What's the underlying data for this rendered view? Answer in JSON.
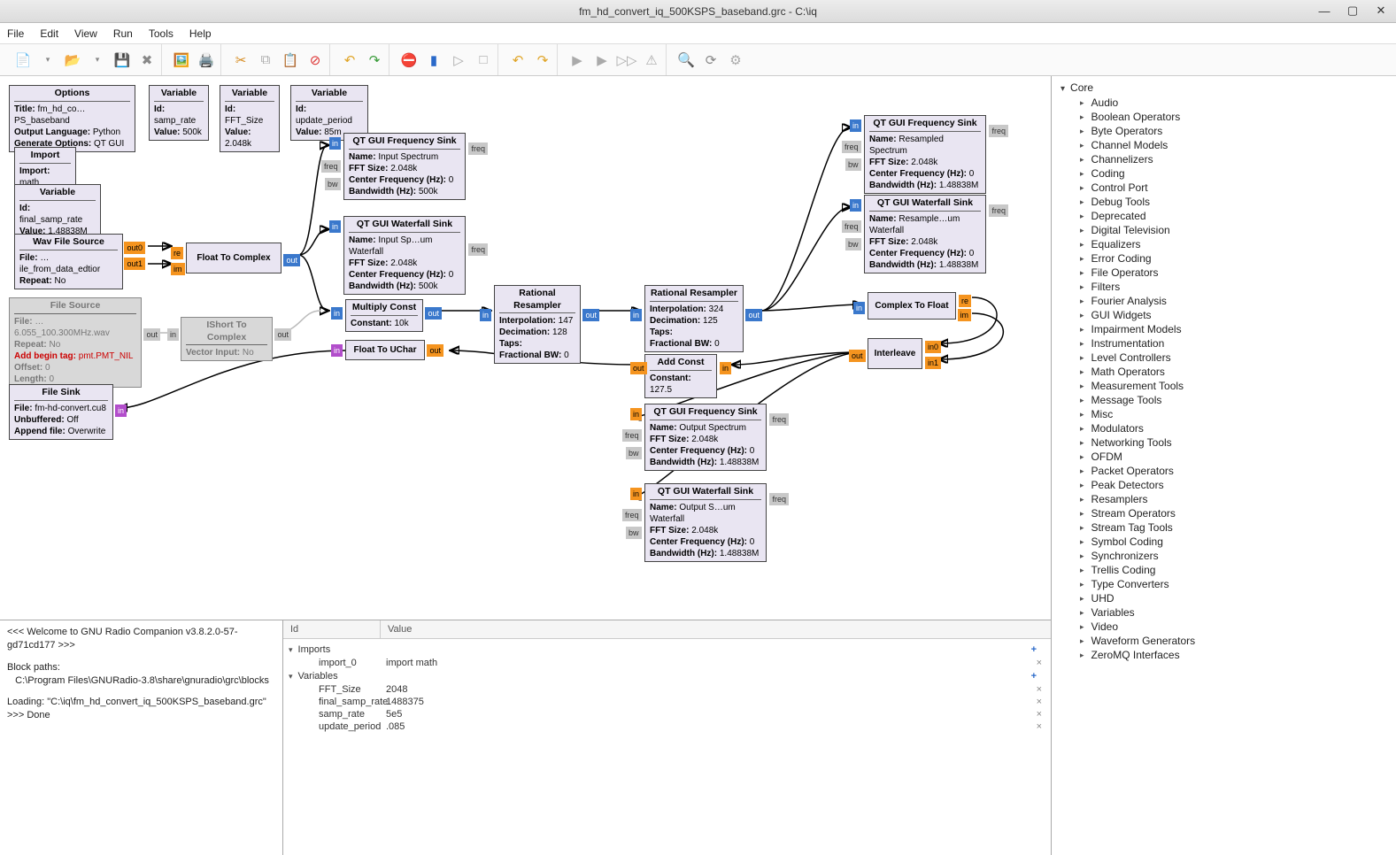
{
  "titlebar": {
    "title": "fm_hd_convert_iq_500KSPS_baseband.grc - C:\\iq"
  },
  "menu": [
    "File",
    "Edit",
    "View",
    "Run",
    "Tools",
    "Help"
  ],
  "sidebar": {
    "root": "Core",
    "items": [
      "Audio",
      "Boolean Operators",
      "Byte Operators",
      "Channel Models",
      "Channelizers",
      "Coding",
      "Control Port",
      "Debug Tools",
      "Deprecated",
      "Digital Television",
      "Equalizers",
      "Error Coding",
      "File Operators",
      "Filters",
      "Fourier Analysis",
      "GUI Widgets",
      "Impairment Models",
      "Instrumentation",
      "Level Controllers",
      "Math Operators",
      "Measurement Tools",
      "Message Tools",
      "Misc",
      "Modulators",
      "Networking Tools",
      "OFDM",
      "Packet Operators",
      "Peak Detectors",
      "Resamplers",
      "Stream Operators",
      "Stream Tag Tools",
      "Symbol Coding",
      "Synchronizers",
      "Trellis Coding",
      "Type Converters",
      "UHD",
      "Variables",
      "Video",
      "Waveform Generators",
      "ZeroMQ Interfaces"
    ]
  },
  "console": {
    "welcome": "<<< Welcome to GNU Radio Companion v3.8.2.0-57-gd71cd177 >>>",
    "paths_label": "Block paths:",
    "paths": "C:\\Program Files\\GNURadio-3.8\\share\\gnuradio\\grc\\blocks",
    "loading": "Loading: \"C:\\iq\\fm_hd_convert_iq_500KSPS_baseband.grc\"",
    "done": ">>> Done"
  },
  "vars": {
    "col_id": "Id",
    "col_val": "Value",
    "sec_imports": "Imports",
    "import_id": "import_0",
    "import_val": "import math",
    "sec_vars": "Variables",
    "rows": [
      {
        "id": "FFT_Size",
        "val": "2048"
      },
      {
        "id": "final_samp_rate",
        "val": "1488375"
      },
      {
        "id": "samp_rate",
        "val": "5e5"
      },
      {
        "id": "update_period",
        "val": ".085"
      }
    ]
  },
  "blocks": {
    "options": {
      "t": "Options",
      "l1": "Title:",
      "v1": "fm_hd_co…PS_baseband",
      "l2": "Output Language:",
      "v2": "Python",
      "l3": "Generate Options:",
      "v3": "QT GUI"
    },
    "var1": {
      "t": "Variable",
      "l1": "Id:",
      "v1": "samp_rate",
      "l2": "Value:",
      "v2": "500k"
    },
    "var2": {
      "t": "Variable",
      "l1": "Id:",
      "v1": "FFT_Size",
      "l2": "Value:",
      "v2": "2.048k"
    },
    "var3": {
      "t": "Variable",
      "l1": "Id:",
      "v1": "update_period",
      "l2": "Value:",
      "v2": "85m"
    },
    "import": {
      "t": "Import",
      "l1": "Import:",
      "v1": "math"
    },
    "var4": {
      "t": "Variable",
      "l1": "Id:",
      "v1": "final_samp_rate",
      "l2": "Value:",
      "v2": "1.48838M"
    },
    "wavsrc": {
      "t": "Wav File Source",
      "l1": "File:",
      "v1": "…ile_from_data_edtior",
      "l2": "Repeat:",
      "v2": "No"
    },
    "filesrc": {
      "t": "File Source",
      "l1": "File:",
      "v1": "…6.055_100.300MHz.wav",
      "l2": "Repeat:",
      "v2": "No",
      "l3": "Add begin tag:",
      "v3": "pmt.PMT_NIL",
      "l4": "Offset:",
      "v4": "0",
      "l5": "Length:",
      "v5": "0"
    },
    "filesink": {
      "t": "File Sink",
      "l1": "File:",
      "v1": "fm-hd-convert.cu8",
      "l2": "Unbuffered:",
      "v2": "Off",
      "l3": "Append file:",
      "v3": "Overwrite"
    },
    "f2c": {
      "t": "Float To Complex"
    },
    "is2c": {
      "t": "IShort To Complex",
      "l1": "Vector Input:",
      "v1": "No"
    },
    "freqsink1": {
      "t": "QT GUI Frequency Sink",
      "l1": "Name:",
      "v1": "Input Spectrum",
      "l2": "FFT Size:",
      "v2": "2.048k",
      "l3": "Center Frequency (Hz):",
      "v3": "0",
      "l4": "Bandwidth (Hz):",
      "v4": "500k"
    },
    "wfsink1": {
      "t": "QT GUI Waterfall Sink",
      "l1": "Name:",
      "v1": "Input Sp…um Waterfall",
      "l2": "FFT Size:",
      "v2": "2.048k",
      "l3": "Center Frequency (Hz):",
      "v3": "0",
      "l4": "Bandwidth (Hz):",
      "v4": "500k"
    },
    "mulconst": {
      "t": "Multiply Const",
      "l1": "Constant:",
      "v1": "10k"
    },
    "f2uc": {
      "t": "Float To UChar"
    },
    "rr1": {
      "t": "Rational Resampler",
      "l1": "Interpolation:",
      "v1": "147",
      "l2": "Decimation:",
      "v2": "128",
      "l3": "Taps:",
      "v3": "",
      "l4": "Fractional BW:",
      "v4": "0"
    },
    "rr2": {
      "t": "Rational Resampler",
      "l1": "Interpolation:",
      "v1": "324",
      "l2": "Decimation:",
      "v2": "125",
      "l3": "Taps:",
      "v3": "",
      "l4": "Fractional BW:",
      "v4": "0"
    },
    "addconst": {
      "t": "Add Const",
      "l1": "Constant:",
      "v1": "127.5"
    },
    "freqsink2": {
      "t": "QT GUI Frequency Sink",
      "l1": "Name:",
      "v1": "Output Spectrum",
      "l2": "FFT Size:",
      "v2": "2.048k",
      "l3": "Center Frequency (Hz):",
      "v3": "0",
      "l4": "Bandwidth (Hz):",
      "v4": "1.48838M"
    },
    "wfsink2": {
      "t": "QT GUI Waterfall Sink",
      "l1": "Name:",
      "v1": "Output S…um Waterfall",
      "l2": "FFT Size:",
      "v2": "2.048k",
      "l3": "Center Frequency (Hz):",
      "v3": "0",
      "l4": "Bandwidth (Hz):",
      "v4": "1.48838M"
    },
    "freqsink3": {
      "t": "QT GUI Frequency Sink",
      "l1": "Name:",
      "v1": "Resampled Spectrum",
      "l2": "FFT Size:",
      "v2": "2.048k",
      "l3": "Center Frequency (Hz):",
      "v3": "0",
      "l4": "Bandwidth (Hz):",
      "v4": "1.48838M"
    },
    "wfsink3": {
      "t": "QT GUI Waterfall Sink",
      "l1": "Name:",
      "v1": "Resample…um Waterfall",
      "l2": "FFT Size:",
      "v2": "2.048k",
      "l3": "Center Frequency (Hz):",
      "v3": "0",
      "l4": "Bandwidth (Hz):",
      "v4": "1.48838M"
    },
    "c2f": {
      "t": "Complex To Float"
    },
    "interleave": {
      "t": "Interleave"
    }
  },
  "ports": {
    "out": "out",
    "out0": "out0",
    "out1": "out1",
    "in": "in",
    "in0": "in0",
    "in1": "in1",
    "re": "re",
    "im": "im",
    "freq": "freq",
    "bw": "bw"
  }
}
